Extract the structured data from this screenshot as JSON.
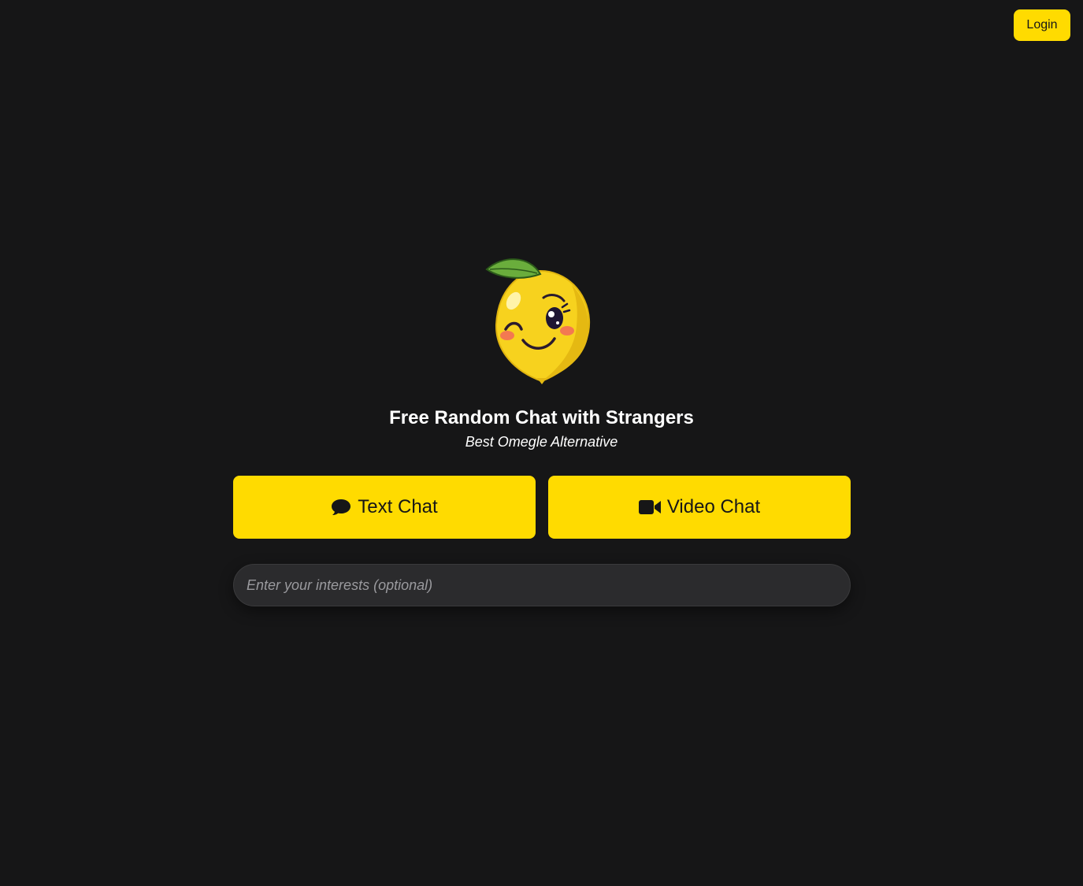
{
  "header": {
    "login_label": "Login"
  },
  "hero": {
    "mascot_icon": "lemon-mascot-icon",
    "title": "Free Random Chat with Strangers",
    "subtitle": "Best Omegle Alternative"
  },
  "actions": {
    "text_chat": {
      "label": "Text Chat",
      "icon": "speech-bubble-icon"
    },
    "video_chat": {
      "label": "Video Chat",
      "icon": "video-camera-icon"
    }
  },
  "interests": {
    "value": "",
    "placeholder": "Enter your interests (optional)"
  },
  "colors": {
    "background": "#161617",
    "accent": "#ffdb00",
    "input_background": "#2b2b2d",
    "text": "#ffffff"
  }
}
